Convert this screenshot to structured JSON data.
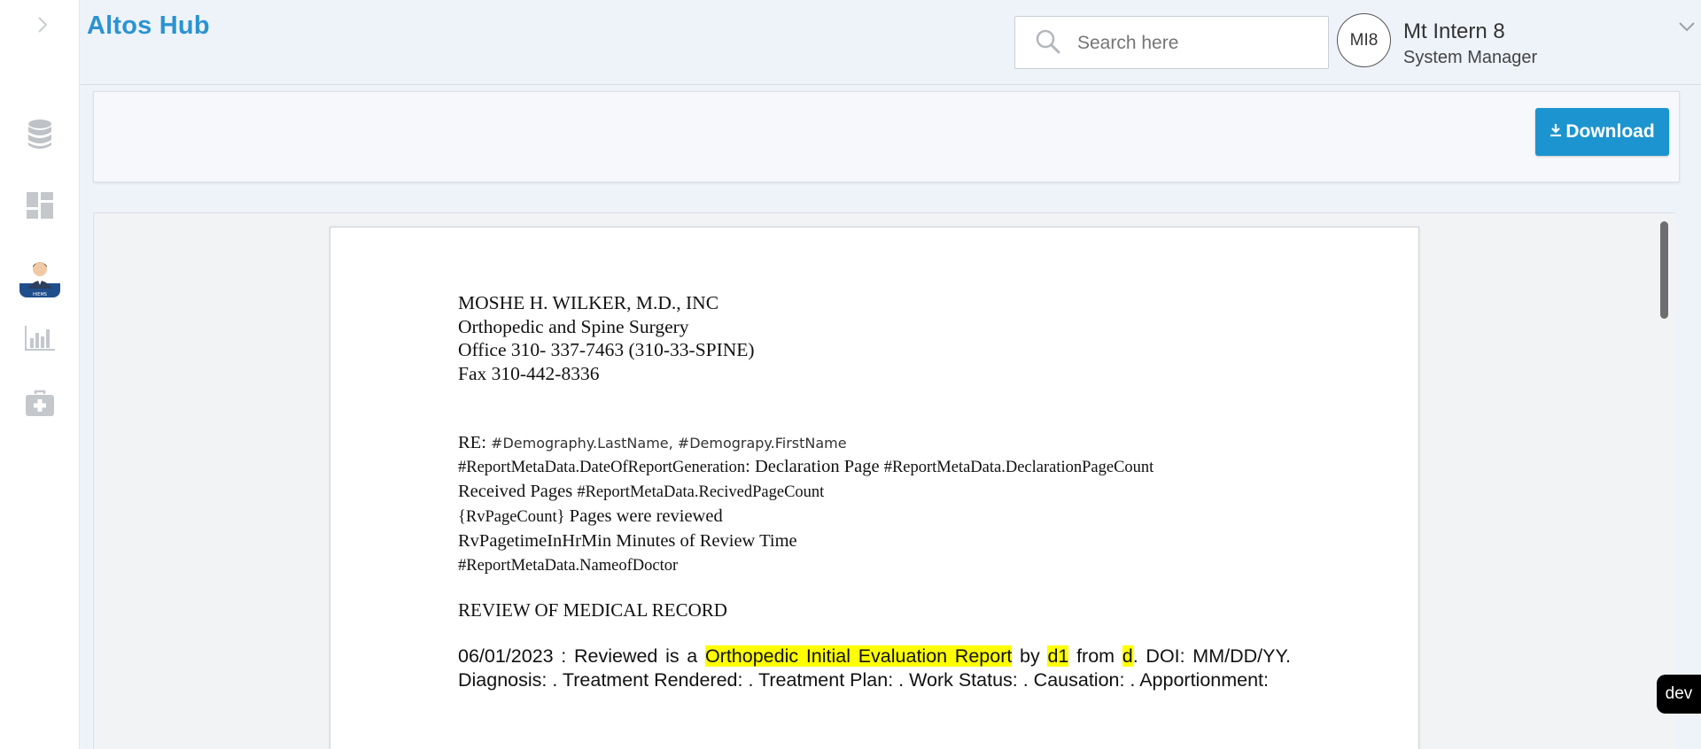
{
  "app": {
    "title": "Altos Hub"
  },
  "sidebar": {
    "items": [
      {
        "icon": "database-icon"
      },
      {
        "icon": "dashboard-icon"
      },
      {
        "icon": "doctor-avatar-icon",
        "badge_text": "HIEMS"
      },
      {
        "icon": "bar-chart-icon"
      },
      {
        "icon": "medical-kit-icon"
      }
    ]
  },
  "header": {
    "search": {
      "placeholder": "Search here",
      "value": ""
    },
    "user": {
      "initials": "MI8",
      "name": "Mt Intern 8",
      "role": "System Manager"
    }
  },
  "toolbar": {
    "download_label": "Download"
  },
  "document": {
    "letterhead": [
      "MOSHE H. WILKER, M.D., INC",
      "Orthopedic and Spine Surgery",
      "Office 310- 337-7463 (310-33-SPINE)",
      "Fax 310-442-8336"
    ],
    "re_label": "RE: ",
    "re_code": "#Demography.LastName, #Demograpy.FirstName",
    "date_code": "#ReportMetaData.DateOfReportGeneration",
    "declaration_text": ": Declaration Page ",
    "declaration_code": "#ReportMetaData.DeclarationPageCount",
    "received_text": "Received Pages ",
    "received_code": "#ReportMetaData.RecivedPageCount",
    "reviewed_code": "{RvPageCount}",
    "reviewed_text": " Pages were reviewed",
    "review_time_code": "RvPagetimeInHrMin",
    "review_time_text": " Minutes of Review Time",
    "doctor_code": "#ReportMetaData.NameofDoctor",
    "section_title": "REVIEW OF MEDICAL RECORD",
    "summary": {
      "date": "06/01/2023",
      "lead": " :  Reviewed is a ",
      "report_type": "Orthopedic Initial Evaluation Report",
      "by_text": " by ",
      "author": "d1",
      "from_text": " from ",
      "source": "d",
      "rest": ".  DOI: MM/DD/YY.  Diagnosis:  .  Treatment Rendered:  .  Treatment Plan:  .  Work Status:  .  Causation:  .  Apportionment:"
    }
  },
  "env_badge": "dev",
  "colors": {
    "brand": "#2b93d1",
    "button": "#1c94cf",
    "highlight": "#ffff00"
  }
}
